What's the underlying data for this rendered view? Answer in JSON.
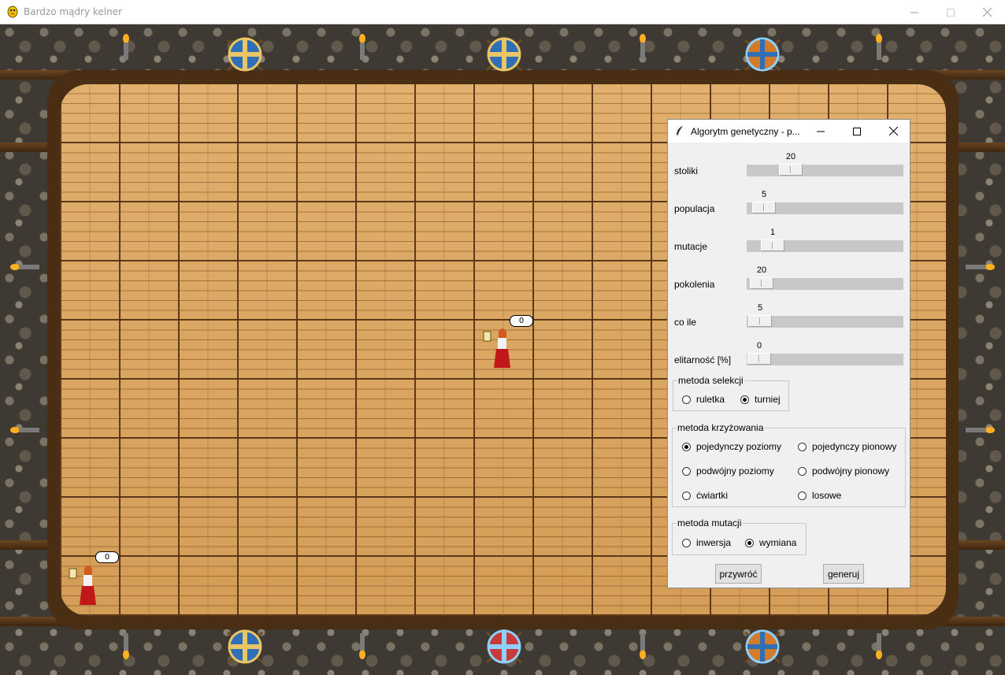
{
  "window": {
    "title": "Bardzo mądry kelner"
  },
  "waitresses": [
    {
      "counter": "0"
    },
    {
      "counter": "0"
    }
  ],
  "dialog": {
    "title": "Algorytm genetyczny - p...",
    "sliders": [
      {
        "label": "stoliki",
        "value": "20"
      },
      {
        "label": "populacja",
        "value": "5"
      },
      {
        "label": "mutacje",
        "value": "1"
      },
      {
        "label": "pokolenia",
        "value": "20"
      },
      {
        "label": "co ile",
        "value": "5"
      },
      {
        "label": "elitarność [%]",
        "value": "0"
      }
    ],
    "selection": {
      "label": "metoda selekcji",
      "options": [
        "ruletka",
        "turniej"
      ],
      "selected": "turniej"
    },
    "crossover": {
      "label": "metoda krzyżowania",
      "options": [
        "pojedynczy poziomy",
        "pojedynczy pionowy",
        "podwójny poziomy",
        "podwójny pionowy",
        "ćwiartki",
        "losowe"
      ],
      "selected": "pojedynczy poziomy"
    },
    "mutation": {
      "label": "metoda mutacji",
      "options": [
        "inwersja",
        "wymiana"
      ],
      "selected": "wymiana"
    },
    "buttons": {
      "reset": "przywróć",
      "generate": "generuj"
    }
  }
}
